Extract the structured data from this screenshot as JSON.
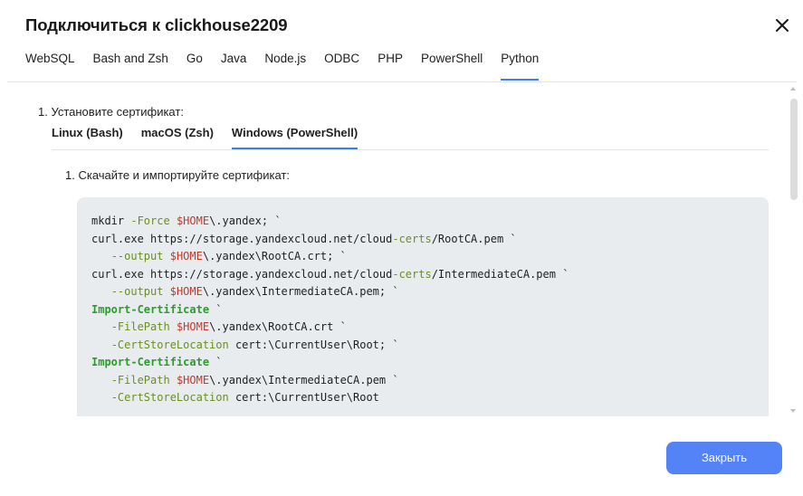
{
  "dialog": {
    "title": "Подключиться к clickhouse2209",
    "close_icon": "close-icon",
    "tabs": [
      {
        "label": "WebSQL",
        "active": false
      },
      {
        "label": "Bash and Zsh",
        "active": false
      },
      {
        "label": "Go",
        "active": false
      },
      {
        "label": "Java",
        "active": false
      },
      {
        "label": "Node.js",
        "active": false
      },
      {
        "label": "ODBC",
        "active": false
      },
      {
        "label": "PHP",
        "active": false
      },
      {
        "label": "PowerShell",
        "active": false
      },
      {
        "label": "Python",
        "active": true
      }
    ]
  },
  "content": {
    "step1": "1. Установите сертификат:",
    "os_tabs": [
      {
        "label": "Linux (Bash)",
        "active": false
      },
      {
        "label": "macOS (Zsh)",
        "active": false
      },
      {
        "label": "Windows (PowerShell)",
        "active": true
      }
    ],
    "substep1": "1. Скачайте и импортируйте сертификат:",
    "code_lines": [
      [
        {
          "t": "mkdir "
        },
        {
          "t": "-Force",
          "c": "param"
        },
        {
          "t": " "
        },
        {
          "t": "$HOME",
          "c": "var"
        },
        {
          "t": "\\.yandex; `"
        }
      ],
      [
        {
          "t": "curl.exe https://storage.yandexcloud.net/cloud"
        },
        {
          "t": "-certs",
          "c": "param"
        },
        {
          "t": "/RootCA.pem `"
        }
      ],
      [
        {
          "t": "   "
        },
        {
          "t": "--output",
          "c": "param"
        },
        {
          "t": " "
        },
        {
          "t": "$HOME",
          "c": "var"
        },
        {
          "t": "\\.yandex\\RootCA.crt; `"
        }
      ],
      [
        {
          "t": "curl.exe https://storage.yandexcloud.net/cloud"
        },
        {
          "t": "-certs",
          "c": "param"
        },
        {
          "t": "/IntermediateCA.pem `"
        }
      ],
      [
        {
          "t": "   "
        },
        {
          "t": "--output",
          "c": "param"
        },
        {
          "t": " "
        },
        {
          "t": "$HOME",
          "c": "var"
        },
        {
          "t": "\\.yandex\\IntermediateCA.pem; `"
        }
      ],
      [
        {
          "t": "Import-Certificate",
          "c": "kw"
        },
        {
          "t": " `"
        }
      ],
      [
        {
          "t": "   "
        },
        {
          "t": "-FilePath",
          "c": "param"
        },
        {
          "t": " "
        },
        {
          "t": "$HOME",
          "c": "var"
        },
        {
          "t": "\\.yandex\\RootCA.crt `"
        }
      ],
      [
        {
          "t": "   "
        },
        {
          "t": "-CertStoreLocation",
          "c": "param"
        },
        {
          "t": " cert:\\CurrentUser\\Root; `"
        }
      ],
      [
        {
          "t": "Import-Certificate",
          "c": "kw"
        },
        {
          "t": " `"
        }
      ],
      [
        {
          "t": "   "
        },
        {
          "t": "-FilePath",
          "c": "param"
        },
        {
          "t": " "
        },
        {
          "t": "$HOME",
          "c": "var"
        },
        {
          "t": "\\.yandex\\IntermediateCA.pem `"
        }
      ],
      [
        {
          "t": "   "
        },
        {
          "t": "-CertStoreLocation",
          "c": "param"
        },
        {
          "t": " cert:\\CurrentUser\\Root"
        }
      ]
    ]
  },
  "footer": {
    "close_button_label": "Закрыть"
  },
  "colors": {
    "accent": "#3d7ff0",
    "button": "#5483f7",
    "code_bg": "#e9ecef",
    "code_param": "#6b8e23",
    "code_var": "#c0392b",
    "code_keyword": "#2e9a2e"
  }
}
